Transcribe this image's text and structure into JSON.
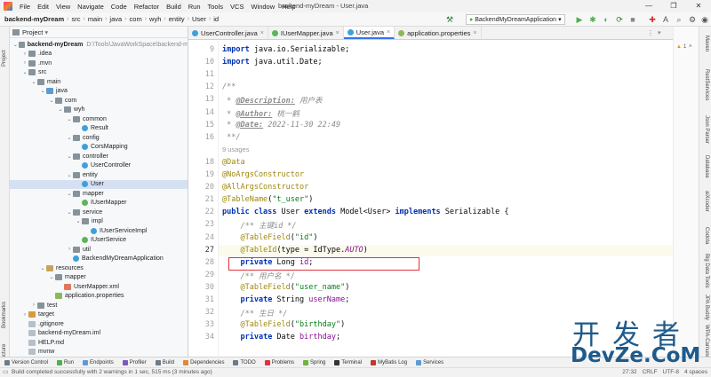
{
  "window": {
    "title": "backend-myDream - User.java",
    "menu": [
      "File",
      "Edit",
      "View",
      "Navigate",
      "Code",
      "Refactor",
      "Build",
      "Run",
      "Tools",
      "VCS",
      "Window",
      "Help"
    ],
    "controls": [
      "—",
      "❐",
      "✕"
    ]
  },
  "breadcrumbs": [
    "backend-myDream",
    "src",
    "main",
    "java",
    "com",
    "wyh",
    "entity",
    "User",
    "id"
  ],
  "run_config": "BackendMyDreamApplication",
  "project_panel": {
    "title": "Project",
    "tree": [
      {
        "label": "backend-myDream",
        "extra": "D:\\Tools\\JavaWorkSpace\\backend-m",
        "depth": 0,
        "icon": "folder",
        "open": true,
        "bold": true
      },
      {
        "label": ".idea",
        "depth": 1,
        "icon": "folder",
        "open": false
      },
      {
        "label": ".mvn",
        "depth": 1,
        "icon": "folder",
        "open": false
      },
      {
        "label": "src",
        "depth": 1,
        "icon": "folder",
        "open": true
      },
      {
        "label": "main",
        "depth": 2,
        "icon": "folder",
        "open": true
      },
      {
        "label": "java",
        "depth": 3,
        "icon": "folder-src",
        "open": true
      },
      {
        "label": "com",
        "depth": 4,
        "icon": "folder",
        "open": true
      },
      {
        "label": "wyh",
        "depth": 5,
        "icon": "folder",
        "open": true
      },
      {
        "label": "common",
        "depth": 6,
        "icon": "folder",
        "open": true
      },
      {
        "label": "Result",
        "depth": 7,
        "icon": "class"
      },
      {
        "label": "config",
        "depth": 6,
        "icon": "folder",
        "open": true
      },
      {
        "label": "CorsMapping",
        "depth": 7,
        "icon": "class"
      },
      {
        "label": "controller",
        "depth": 6,
        "icon": "folder",
        "open": true
      },
      {
        "label": "UserController",
        "depth": 7,
        "icon": "class"
      },
      {
        "label": "entity",
        "depth": 6,
        "icon": "folder",
        "open": true
      },
      {
        "label": "User",
        "depth": 7,
        "icon": "class",
        "selected": true
      },
      {
        "label": "mapper",
        "depth": 6,
        "icon": "folder",
        "open": true
      },
      {
        "label": "IUserMapper",
        "depth": 7,
        "icon": "iface"
      },
      {
        "label": "service",
        "depth": 6,
        "icon": "folder",
        "open": true
      },
      {
        "label": "impl",
        "depth": 7,
        "icon": "folder",
        "open": true
      },
      {
        "label": "IUserServiceImpl",
        "depth": 8,
        "icon": "class"
      },
      {
        "label": "IUserService",
        "depth": 7,
        "icon": "iface"
      },
      {
        "label": "util",
        "depth": 6,
        "icon": "folder",
        "open": false
      },
      {
        "label": "BackendMyDreamApplication",
        "depth": 6,
        "icon": "class"
      },
      {
        "label": "resources",
        "depth": 3,
        "icon": "folder-res",
        "open": true
      },
      {
        "label": "mapper",
        "depth": 4,
        "icon": "folder",
        "open": true
      },
      {
        "label": "UserMapper.xml",
        "depth": 5,
        "icon": "xml"
      },
      {
        "label": "application.properties",
        "depth": 4,
        "icon": "props"
      },
      {
        "label": "test",
        "depth": 2,
        "icon": "folder",
        "open": false
      },
      {
        "label": "target",
        "depth": 1,
        "icon": "folder-orange",
        "open": false
      },
      {
        "label": ".gitignore",
        "depth": 1,
        "icon": "file"
      },
      {
        "label": "backend-myDream.iml",
        "depth": 1,
        "icon": "file"
      },
      {
        "label": "HELP.md",
        "depth": 1,
        "icon": "file"
      },
      {
        "label": "mvnw",
        "depth": 1,
        "icon": "file"
      }
    ]
  },
  "tabs": [
    {
      "label": "UserController.java",
      "icon": "class",
      "active": false
    },
    {
      "label": "IUserMapper.java",
      "icon": "iface",
      "active": false
    },
    {
      "label": "User.java",
      "icon": "class",
      "active": true
    },
    {
      "label": "application.properties",
      "icon": "props",
      "active": false
    }
  ],
  "editor": {
    "usages_hint": "9 usages",
    "lines": [
      {
        "n": "9",
        "html": "<span class=\"kw\">import</span> java.io.Serializable;"
      },
      {
        "n": "10",
        "html": "<span class=\"kw\">import</span> java.util.Date;"
      },
      {
        "n": "11",
        "html": ""
      },
      {
        "n": "12",
        "html": "<span class=\"doc\">/**</span>"
      },
      {
        "n": "13",
        "html": "<span class=\"doc\"> * </span><span class=\"doctag\">@Description:</span><span class=\"doc\"> 用户表</span>"
      },
      {
        "n": "14",
        "html": "<span class=\"doc\"> * </span><span class=\"doctag\">@Author:</span><span class=\"doc\"> 桃一鹤</span>"
      },
      {
        "n": "15",
        "html": "<span class=\"doc\"> * </span><span class=\"doctag\">@Date:</span><span class=\"doc\"> 2022-11-30 22:49</span>"
      },
      {
        "n": "16",
        "html": "<span class=\"doc\"> **/</span>"
      },
      {
        "n": "",
        "html": "<span class=\"hint\">9 usages</span>"
      },
      {
        "n": "18",
        "html": "<span class=\"ann\">@Data</span>"
      },
      {
        "n": "19",
        "html": "<span class=\"ann\">@NoArgsConstructor</span>"
      },
      {
        "n": "20",
        "html": "<span class=\"ann\">@AllArgsConstructor</span>"
      },
      {
        "n": "21",
        "html": "<span class=\"ann\">@TableName</span>(<span class=\"str\">\"t_user\"</span>)"
      },
      {
        "n": "22",
        "html": "<span class=\"kw\">public class</span> User <span class=\"kw\">extends</span> Model&lt;User&gt; <span class=\"kw\">implements</span> Serializable {"
      },
      {
        "n": "23",
        "html": "    <span class=\"cmt\">/** 主键id */</span>"
      },
      {
        "n": "24",
        "html": "    <span class=\"ann\">@TableField</span>(<span class=\"str\">\"id\"</span>)"
      },
      {
        "n": "27",
        "html": "    <span class=\"ann\">@TableId</span>(type = IdType.<span class=\"const\">AUTO</span>)",
        "current": true
      },
      {
        "n": "28",
        "html": "    <span class=\"kw\">private</span> Long <span class=\"fld\">id</span>;"
      },
      {
        "n": "29",
        "html": "    <span class=\"cmt\">/** 用户名 */</span>"
      },
      {
        "n": "30",
        "html": "    <span class=\"ann\">@TableField</span>(<span class=\"str\">\"user_name\"</span>)"
      },
      {
        "n": "31",
        "html": "    <span class=\"kw\">private</span> String <span class=\"fld\">userName</span>;"
      },
      {
        "n": "32",
        "html": "    <span class=\"cmt\">/** 生日 */</span>"
      },
      {
        "n": "33",
        "html": "    <span class=\"ann\">@TableField</span>(<span class=\"str\">\"birthday\"</span>)"
      },
      {
        "n": "34",
        "html": "    <span class=\"kw\">private</span> Date <span class=\"fld\">birthday</span>;"
      }
    ]
  },
  "left_strip_labels": [
    "Project",
    "Bookmarks",
    "Structure"
  ],
  "right_strip_labels": [
    "Maven",
    "RestServices",
    "Json Parser",
    "Database",
    "aiXcoder",
    "Codota",
    "Big Data Tools",
    "JPA Buddy",
    "WPA-Camunda"
  ],
  "tool_windows": [
    {
      "label": "Version Control",
      "color": "#6c7a89"
    },
    {
      "label": "Run",
      "color": "#4caf50"
    },
    {
      "label": "Endpoints",
      "color": "#5b9bd5"
    },
    {
      "label": "Profiler",
      "color": "#7e57c2"
    },
    {
      "label": "Build",
      "color": "#6c7a89"
    },
    {
      "label": "Dependencies",
      "color": "#e08a2c"
    },
    {
      "label": "TODO",
      "color": "#6c7a89"
    },
    {
      "label": "Problems",
      "color": "#e0323e"
    },
    {
      "label": "Spring",
      "color": "#6db33f"
    },
    {
      "label": "Terminal",
      "color": "#333333"
    },
    {
      "label": "MyBatis Log",
      "color": "#c0392b"
    },
    {
      "label": "Services",
      "color": "#5b9bd5"
    }
  ],
  "status": {
    "message": "Build completed successfully with 2 warnings in 1 sec, 515 ms (3 minutes ago)",
    "position": "27:32",
    "line_sep": "CRLF",
    "encoding": "UTF-8",
    "indent": "4 spaces"
  },
  "watermark": {
    "line1": "开发者",
    "line2": "DevZe.CoM"
  },
  "colors": {
    "accent": "#3574f0",
    "selection": "#d5e1f2",
    "highlight_box": "#e0323e"
  }
}
